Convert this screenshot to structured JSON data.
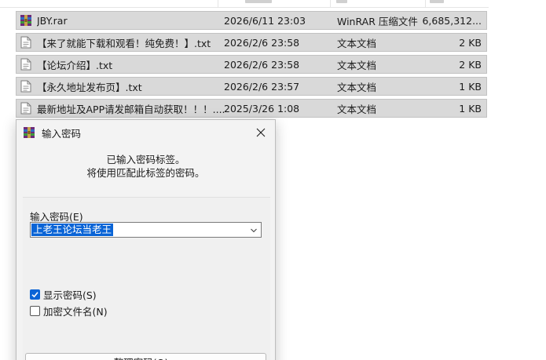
{
  "files": [
    {
      "name": "JBY.rar",
      "date": "2026/6/11 23:03",
      "type": "WinRAR 压缩文件",
      "size": "6,685,312...",
      "icon": "rar-archive-icon"
    },
    {
      "name": "【来了就能下载和观看！纯免费！】.txt",
      "date": "2026/2/6 23:58",
      "type": "文本文档",
      "size": "2 KB",
      "icon": "text-file-icon"
    },
    {
      "name": "【论坛介绍】.txt",
      "date": "2026/2/6 23:58",
      "type": "文本文档",
      "size": "2 KB",
      "icon": "text-file-icon"
    },
    {
      "name": "【永久地址发布页】.txt",
      "date": "2026/2/6 23:57",
      "type": "文本文档",
      "size": "1 KB",
      "icon": "text-file-icon"
    },
    {
      "name": "最新地址及APP请发邮箱自动获取！！！....",
      "date": "2025/3/26 1:08",
      "type": "文本文档",
      "size": "1 KB",
      "icon": "text-file-icon"
    }
  ],
  "dialog": {
    "title": "输入密码",
    "info_line1": "已输入密码标签。",
    "info_line2": "将使用匹配此标签的密码。",
    "password_label": "输入密码(E)",
    "password_value": "上老王论坛当老王",
    "show_password_label": "显示密码(S)",
    "show_password_checked": true,
    "encrypt_names_label": "加密文件名(N)",
    "encrypt_names_checked": false,
    "organize_button": "整理密码(O)..."
  },
  "colors": {
    "row_bg": "#d9d9d9",
    "accent": "#0a64d6",
    "dialog_bg": "#f3f3f3"
  }
}
